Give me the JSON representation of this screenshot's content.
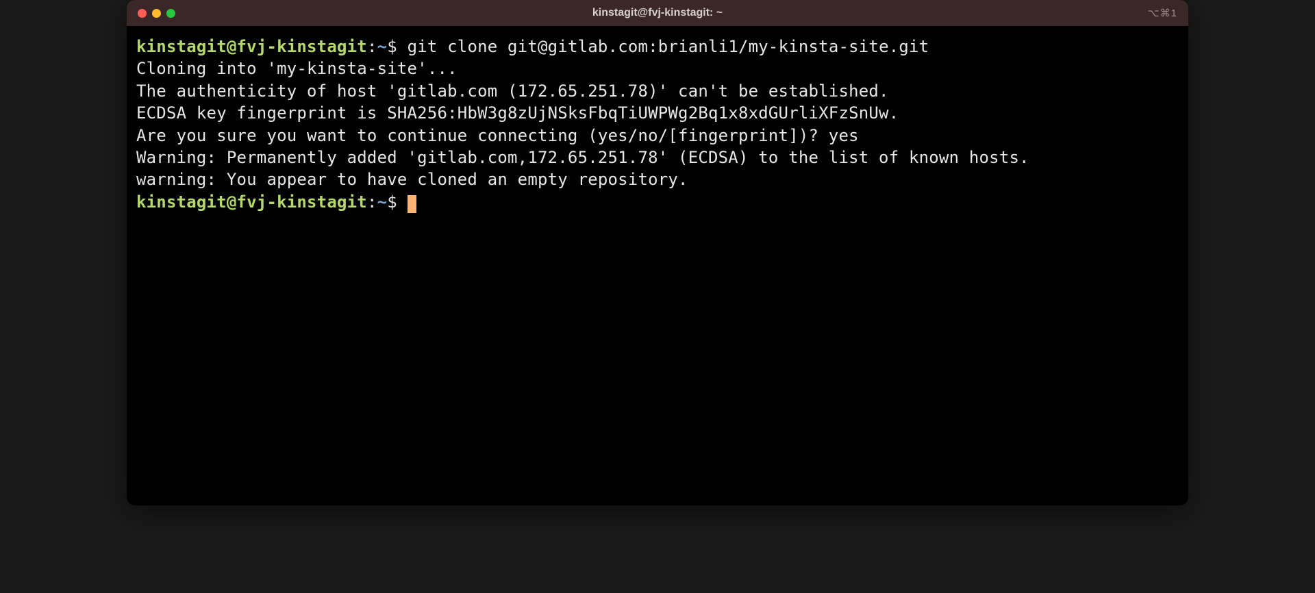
{
  "window": {
    "title": "kinstagit@fvj-kinstagit: ~",
    "right_indicator": "⌥⌘1"
  },
  "prompt": {
    "user_host": "kinstagit@fvj-kinstagit",
    "separator": ":",
    "path": "~",
    "symbol": "$"
  },
  "session": {
    "command": "git clone git@gitlab.com:brianli1/my-kinsta-site.git",
    "output_lines": [
      "Cloning into 'my-kinsta-site'...",
      "The authenticity of host 'gitlab.com (172.65.251.78)' can't be established.",
      "ECDSA key fingerprint is SHA256:HbW3g8zUjNSksFbqTiUWPWg2Bq1x8xdGUrliXFzSnUw.",
      "Are you sure you want to continue connecting (yes/no/[fingerprint])? yes",
      "Warning: Permanently added 'gitlab.com,172.65.251.78' (ECDSA) to the list of known hosts.",
      "warning: You appear to have cloned an empty repository."
    ]
  }
}
